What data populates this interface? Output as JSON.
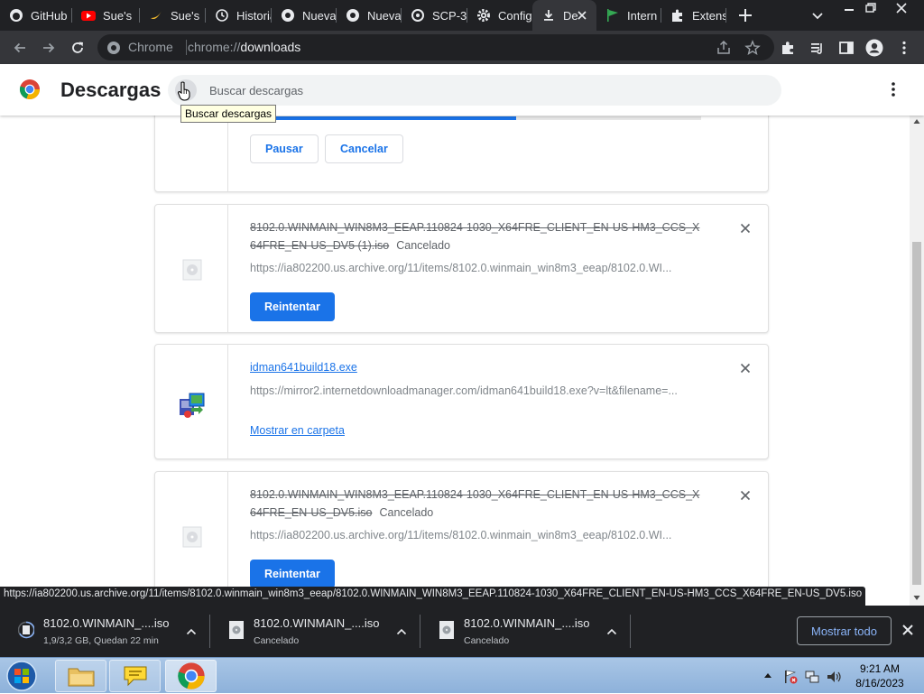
{
  "tabs": [
    {
      "label": "GitHub",
      "icon": "github-icon"
    },
    {
      "label": "Sue's",
      "icon": "youtube-icon"
    },
    {
      "label": "Sue's",
      "icon": "banana-icon"
    },
    {
      "label": "Historial",
      "icon": "history-icon"
    },
    {
      "label": "Nueva",
      "icon": "chrome-tab-icon"
    },
    {
      "label": "Nueva",
      "icon": "chrome-tab-icon"
    },
    {
      "label": "SCP-3",
      "icon": "scp-icon"
    },
    {
      "label": "Config",
      "icon": "gear-icon"
    },
    {
      "label": "De",
      "icon": "download-icon",
      "active": true
    },
    {
      "label": "Intern",
      "icon": "flag-icon"
    },
    {
      "label": "Extens",
      "icon": "puzzle-icon"
    }
  ],
  "omnibox": {
    "chip": "Chrome",
    "url_prefix": "chrome://",
    "url_host": "downloads"
  },
  "page": {
    "title": "Descargas",
    "search_placeholder": "Buscar descargas",
    "search_tooltip": "Buscar descargas"
  },
  "downloads": [
    {
      "name": "",
      "status": "",
      "source": "",
      "progress": 0.59,
      "buttons": [
        "Pausar",
        "Cancelar"
      ]
    },
    {
      "name": "8102.0.WINMAIN_WIN8M3_EEAP.110824-1030_X64FRE_CLIENT_EN-US-HM3_CCS_X64FRE_EN-US_DV5 (1).iso",
      "status": "Cancelado",
      "source": "https://ia802200.us.archive.org/11/items/8102.0.winmain_win8m3_eeap/8102.0.WI...",
      "button": "Reintentar"
    },
    {
      "name": "idman641build18.exe",
      "source": "https://mirror2.internetdownloadmanager.com/idman641build18.exe?v=lt&filename=...",
      "link": "Mostrar en carpeta"
    },
    {
      "name": "8102.0.WINMAIN_WIN8M3_EEAP.110824-1030_X64FRE_CLIENT_EN-US-HM3_CCS_X64FRE_EN-US_DV5.iso",
      "status": "Cancelado",
      "source": "https://ia802200.us.archive.org/11/items/8102.0.winmain_win8m3_eeap/8102.0.WI...",
      "button": "Reintentar"
    }
  ],
  "status_url": "https://ia802200.us.archive.org/11/items/8102.0.winmain_win8m3_eeap/8102.0.WINMAIN_WIN8M3_EEAP.110824-1030_X64FRE_CLIENT_EN-US-HM3_CCS_X64FRE_EN-US_DV5.iso",
  "shelf": {
    "items": [
      {
        "name": "8102.0.WINMAIN_....iso",
        "status": "1,9/3,2 GB, Quedan 22 min"
      },
      {
        "name": "8102.0.WINMAIN_....iso",
        "status": "Cancelado"
      },
      {
        "name": "8102.0.WINMAIN_....iso",
        "status": "Cancelado"
      }
    ],
    "show_all": "Mostrar todo"
  },
  "taskbar": {
    "time": "9:21 AM",
    "date": "8/16/2023"
  },
  "colors": {
    "accent": "#1a73e8",
    "tab_strip": "#202124",
    "toolbar": "#35363a"
  }
}
